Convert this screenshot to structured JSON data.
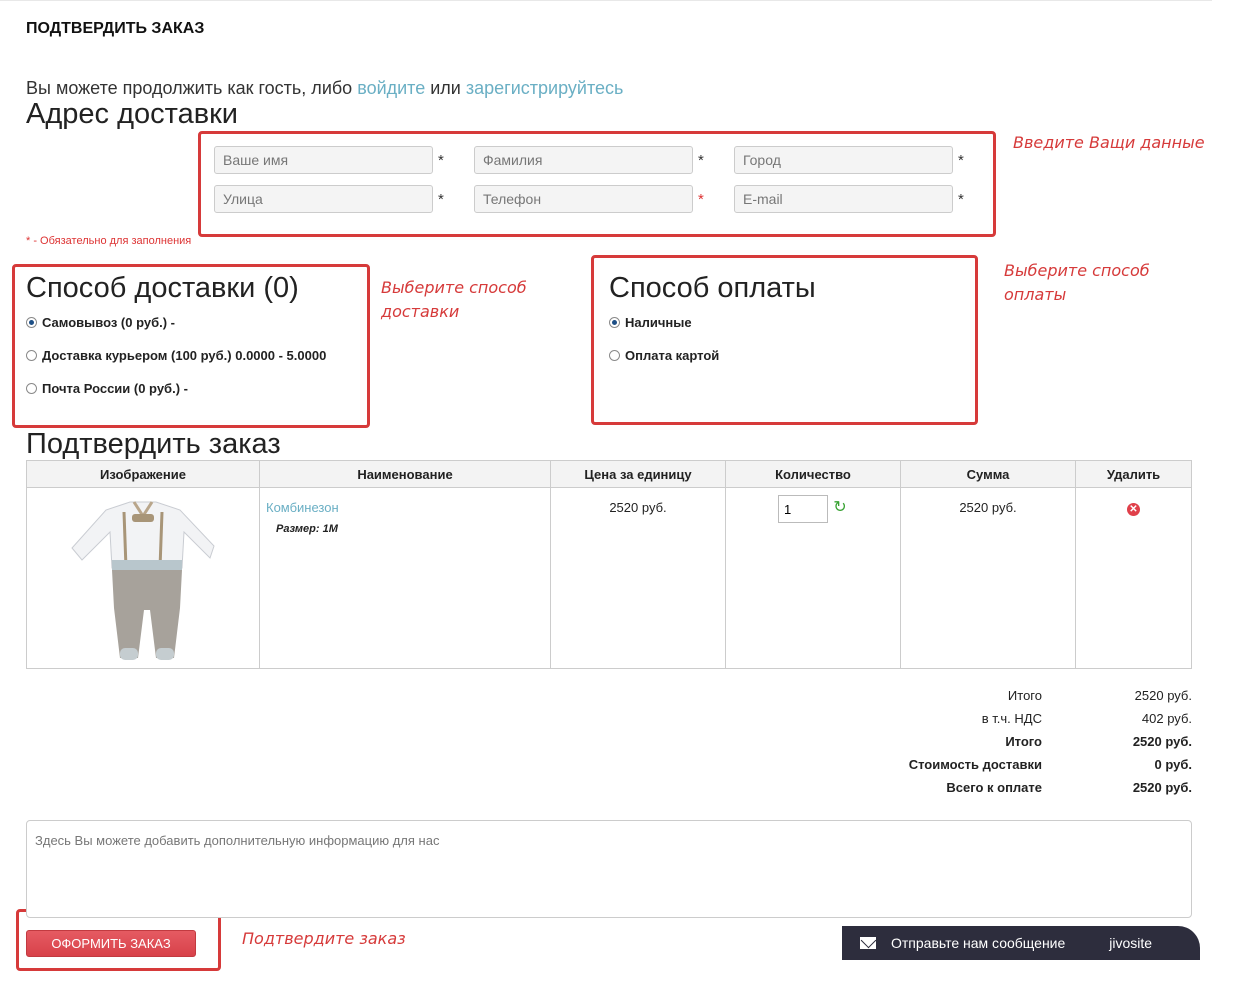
{
  "page_title": "ПОДТВЕРДИТЬ ЗАКАЗ",
  "guest": {
    "prefix": "Вы можете продолжить как гость, либо ",
    "login_link": "войдите",
    "middle": " или ",
    "register_link": "зарегистрируйтесь"
  },
  "address": {
    "heading": "Адрес доставки",
    "fields": {
      "name": "Ваше имя",
      "surname": "Фамилия",
      "city": "Город",
      "street": "Улица",
      "phone": "Телефон",
      "email": "E-mail"
    },
    "star": "*",
    "required_note": "* - Обязательно для заполнения"
  },
  "delivery": {
    "heading": "Способ доставки (0)",
    "options": [
      {
        "label": "Самовывоз (0 руб.) -",
        "checked": true
      },
      {
        "label": "Доставка курьером (100 руб.) 0.0000 - 5.0000",
        "checked": false
      },
      {
        "label": "Почта России (0 руб.) -",
        "checked": false
      }
    ]
  },
  "payment": {
    "heading": "Способ оплаты",
    "options": [
      {
        "label": "Наличные",
        "checked": true
      },
      {
        "label": "Оплата картой",
        "checked": false
      }
    ]
  },
  "annotations": {
    "data": "Введите Ващи данные",
    "delivery": "Выберите способ\nдоставки",
    "payment": "Выберите способ\nоплаты",
    "confirm": "Подтвердите заказ"
  },
  "confirm": {
    "heading": "Подтвердить заказ",
    "columns": [
      "Изображение",
      "Наименование",
      "Цена за единицу",
      "Количество",
      "Сумма",
      "Удалить"
    ],
    "item": {
      "name": "Комбинезон",
      "size": "Размер: 1М",
      "price": "2520 руб.",
      "quantity": "1",
      "sum": "2520 руб."
    }
  },
  "totals": [
    {
      "label": "Итого",
      "value": "2520 руб.",
      "bold": false
    },
    {
      "label": "в т.ч. НДС",
      "value": "402 руб.",
      "bold": false
    },
    {
      "label": "Итого",
      "value": "2520 руб.",
      "bold": true
    },
    {
      "label": "Стоимость доставки",
      "value": "0 руб.",
      "bold": true
    },
    {
      "label": "Всего к оплате",
      "value": "2520 руб.",
      "bold": true
    }
  ],
  "comment_placeholder": "Здесь Вы можете добавить дополнительную информацию для нас",
  "order_button": "ОФОРМИТЬ ЗАКАЗ",
  "jivo": {
    "message": "Отправьте нам сообщение",
    "brand": "jivosite"
  },
  "colors": {
    "link": "#6aafc4",
    "annotation": "#d63a3a",
    "button": "#d8424a",
    "jivo_bg": "#2d2d3d"
  }
}
